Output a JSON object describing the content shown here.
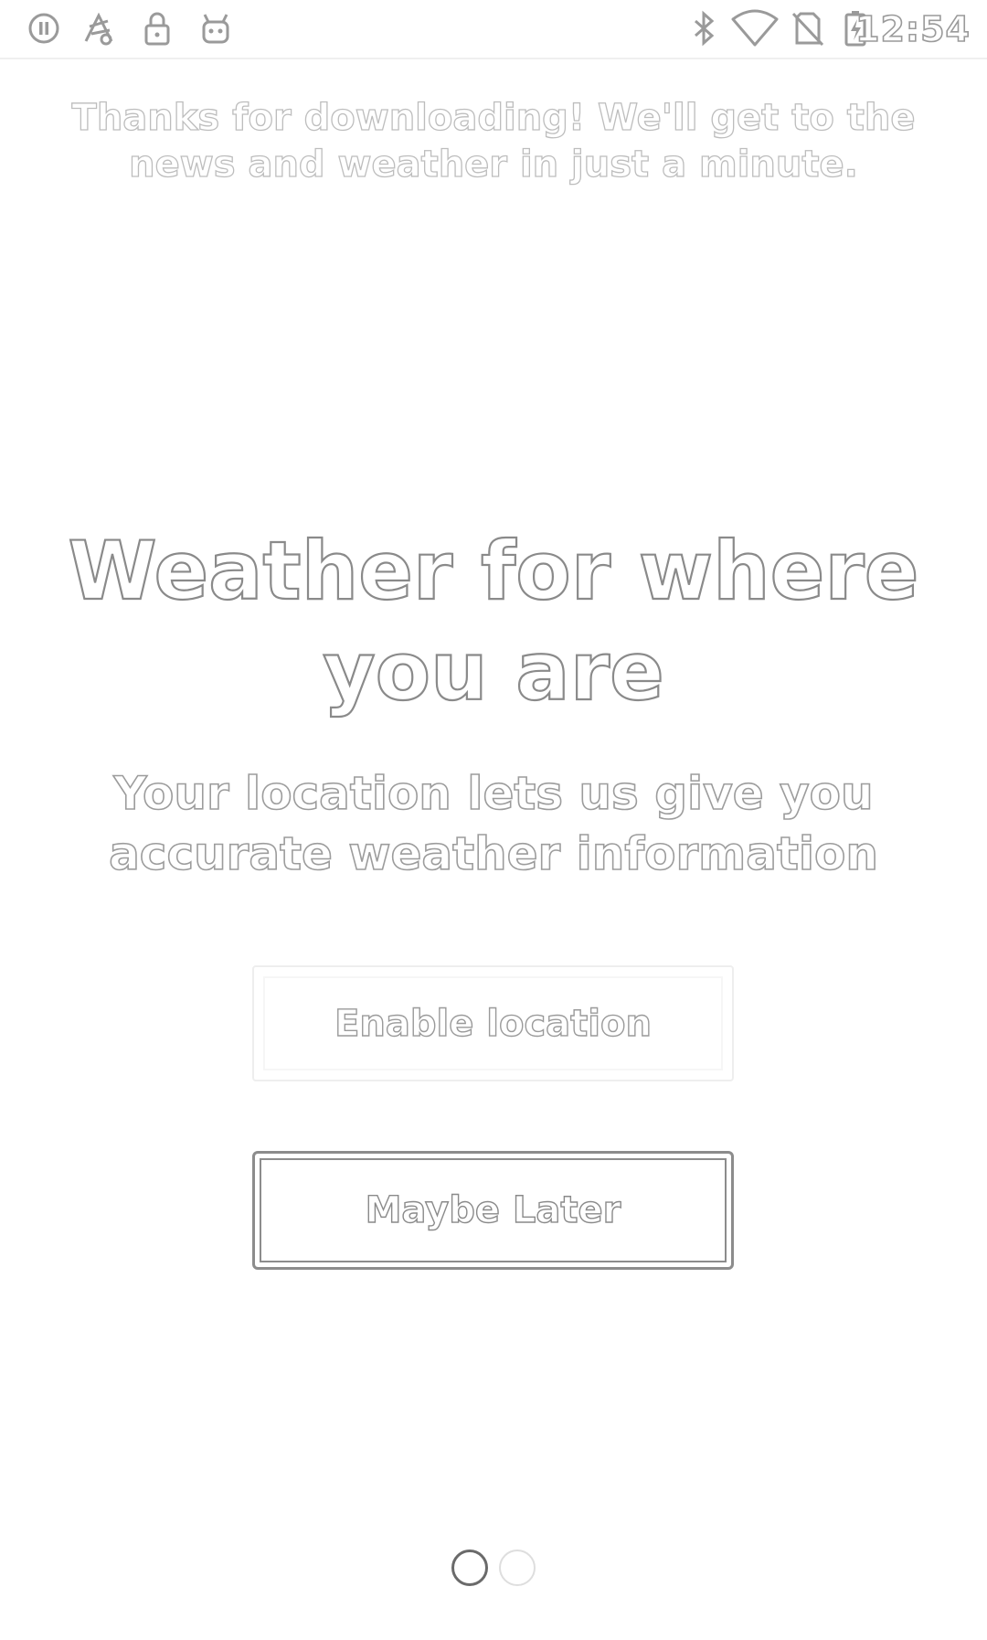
{
  "status_bar": {
    "left_icons": [
      "circle-pause-icon",
      "sports-ball-icon",
      "lock-icon",
      "android-icon"
    ],
    "right_icons": [
      "bluetooth-icon",
      "wifi-icon",
      "no-sim-icon",
      "battery-charging-icon"
    ],
    "time": "12:54"
  },
  "onboarding": {
    "intro_text": "Thanks for downloading! We'll get to the news and weather in just a minute.",
    "title": "Weather for where you are",
    "subtitle": "Your location lets us give you accurate weather information",
    "enable_button_label": "Enable location",
    "later_button_label": "Maybe Later",
    "page_indicator": {
      "current_page": 1,
      "total_pages": 2
    }
  }
}
